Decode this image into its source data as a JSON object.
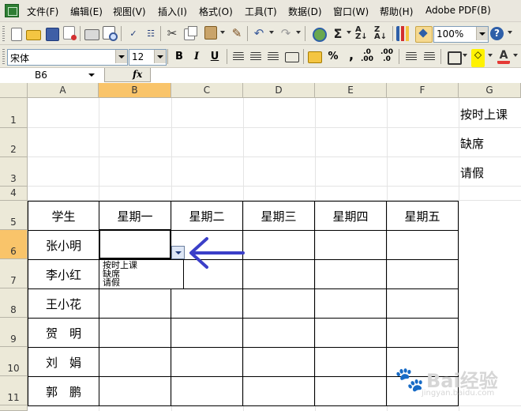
{
  "menu": [
    "文件(F)",
    "编辑(E)",
    "视图(V)",
    "插入(I)",
    "格式(O)",
    "工具(T)",
    "数据(D)",
    "窗口(W)",
    "帮助(H)",
    "Adobe PDF(B)"
  ],
  "toolbar": {
    "zoom": "100%",
    "help_label": "?"
  },
  "format_toolbar": {
    "font": "宋体",
    "font_size": "12",
    "bold": "B",
    "italic": "I",
    "underline": "U",
    "percent": "%",
    "comma": ","
  },
  "formula_bar": {
    "name_box": "B6",
    "fx": "fx",
    "formula": ""
  },
  "columns": [
    "A",
    "B",
    "C",
    "D",
    "E",
    "F",
    "G"
  ],
  "selected_column": "B",
  "rows": [
    "1",
    "2",
    "3",
    "4",
    "5",
    "6",
    "7",
    "8",
    "9",
    "10",
    "11"
  ],
  "selected_row": "6",
  "side_list": [
    "按时上课",
    "缺席",
    "请假"
  ],
  "table": {
    "header": [
      "学生",
      "星期一",
      "星期二",
      "星期三",
      "星期四",
      "星期五"
    ],
    "students": [
      "张小明",
      "李小红",
      "王小花",
      "贺　明",
      "刘　娟",
      "郭　鹏"
    ]
  },
  "dropdown": {
    "options": [
      "按时上课",
      "缺席",
      "请假"
    ]
  },
  "annotation": {
    "arrow_color": "#3b3fc8"
  },
  "watermark": {
    "brand": "Bai",
    "text": "经验",
    "url": "jingyan.baidu.com"
  }
}
